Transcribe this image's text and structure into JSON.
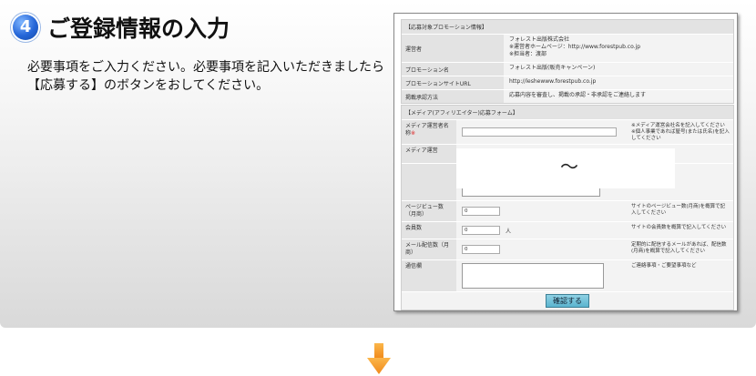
{
  "step": {
    "number": "4",
    "title": "ご登録情報の入力"
  },
  "description": {
    "line1": "必要事項をご入力ください。必要事項を記入いただきましたら",
    "line2": "【応募する】のボタンをおしてください。"
  },
  "campaign_table": {
    "heading": "【応募対象プロモーション情報】",
    "rows": [
      {
        "label": "運営者",
        "values": [
          "フォレスト出版株式会社",
          "※運営者ホームページ：http://www.forestpub.co.jp",
          "※担当者：渡部"
        ]
      },
      {
        "label": "プロモーション名",
        "values": [
          "フォレスト出版(販売キャンペーン)"
        ]
      },
      {
        "label": "プロモーションサイトURL",
        "values": [
          "http://leshewww.forestpub.co.jp"
        ]
      },
      {
        "label": "掲載承認方法",
        "values": [
          "応募内容を審査し、掲載の承認・非承認をご連絡します"
        ]
      }
    ]
  },
  "form": {
    "heading": "【メディア(アフィリエイター)応募フォーム】",
    "media_name": {
      "label": "メディア運営者名称",
      "required_mark": "※",
      "note": "※メディア運営会社名を記入してください　※個人事業であれば屋号(または氏名)を記入してください"
    },
    "media_operator": {
      "label": "メディア運営"
    },
    "tilde": "～",
    "pageviews": {
      "label": "ページビュー数（月商）",
      "value": "0",
      "note": "サイトのページビュー数(月商)を概算で記入してください"
    },
    "members": {
      "label": "会員数",
      "value": "0",
      "unit": "人",
      "note": "サイトの会員数を概算で記入してください"
    },
    "mail_subscribers": {
      "label": "メール配信数（月商）",
      "value": "0",
      "note": "定期的に配信するメールがあれば、配信数(月商)を概算で記入してください"
    },
    "comment": {
      "label": "通信欄",
      "note": "ご連絡事項・ご要望事項など"
    },
    "confirm_label": "確認する"
  },
  "colors": {
    "arrow": "#f39a1e",
    "badge": "#2566d8",
    "confirm": "#6fc0d9"
  }
}
